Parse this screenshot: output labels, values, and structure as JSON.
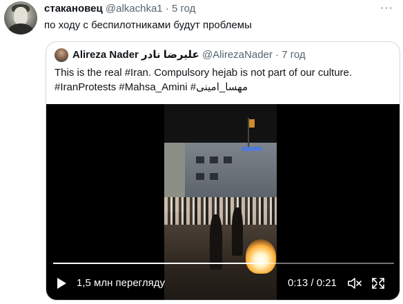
{
  "tweet": {
    "name": "стакановец",
    "handle": "@alkachka1",
    "separator": "·",
    "time": "5 год",
    "text": "по ходу с беспилотниками будут проблемы",
    "more_icon": "more-horizontal-icon"
  },
  "quote": {
    "name": "Alireza Nader علیرضا نادر",
    "handle": "@AlirezaNader",
    "separator": "·",
    "time": "7 год",
    "text_line1": "This is the real #Iran. Compulsory hejab is not part of our culture.",
    "text_line2": "#IranProtests #Mahsa_Amini #مهسا_امینی"
  },
  "video": {
    "views": "1,5 млн перегляду",
    "timecode": "0:13 / 0:21",
    "progress": 0.62,
    "play_icon": "play-icon",
    "mute_icon": "volume-muted-icon",
    "fullscreen_icon": "fullscreen-icon"
  },
  "colors": {
    "secondary_text": "#536471",
    "border": "#cfd9de",
    "video_bg": "#000000"
  }
}
